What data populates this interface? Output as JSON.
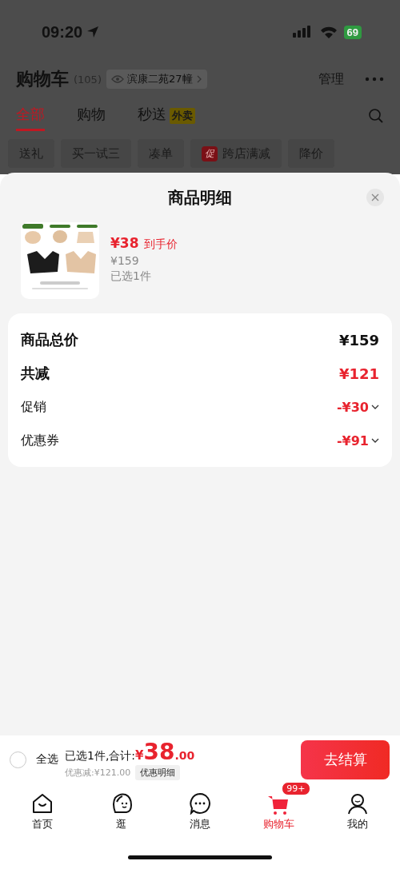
{
  "status_bar": {
    "time": "09:20",
    "battery": "69"
  },
  "header": {
    "title": "购物车",
    "count": "(105)",
    "address": "滨康二苑27幢",
    "manage": "管理"
  },
  "tabs": [
    {
      "label": "全部",
      "selected": true
    },
    {
      "label": "购物",
      "selected": false
    },
    {
      "label": "秒送",
      "selected": false,
      "badge": "外卖"
    }
  ],
  "filters": [
    {
      "label": "送礼"
    },
    {
      "label": "买一试三"
    },
    {
      "label": "凑单"
    },
    {
      "label": "跨店满减",
      "tag": "促"
    },
    {
      "label": "降价"
    }
  ],
  "sheet": {
    "title": "商品明细",
    "product": {
      "price": "¥38",
      "price_note": "到手价",
      "original_price": "¥159",
      "selected_count": "已选1件"
    },
    "summary": [
      {
        "kind": "total",
        "label": "商品总价",
        "value": "¥159"
      },
      {
        "kind": "reduction",
        "label": "共减",
        "value": "¥121"
      },
      {
        "kind": "discount",
        "label": "促销",
        "value": "-¥30"
      },
      {
        "kind": "discount",
        "label": "优惠券",
        "value": "-¥91"
      }
    ]
  },
  "checkout": {
    "select_all": {
      "label": "全选",
      "checked": false
    },
    "summary": "已选1件,合计:",
    "currency": "¥",
    "amount": "38",
    "cents": ".00",
    "discount": "优惠减:¥121.00",
    "detail_button": "优惠明细",
    "button": "去结算"
  },
  "nav": [
    {
      "kind": "home",
      "label": "首页",
      "selected": false
    },
    {
      "kind": "face",
      "label": "逛",
      "selected": false
    },
    {
      "kind": "chat",
      "label": "消息",
      "selected": false
    },
    {
      "kind": "cart",
      "label": "购物车",
      "selected": true,
      "badge": "99+"
    },
    {
      "kind": "person",
      "label": "我的",
      "selected": false
    }
  ]
}
